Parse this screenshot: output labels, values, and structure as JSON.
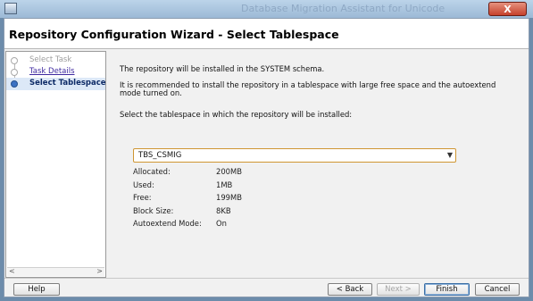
{
  "window": {
    "background_title": "Database Migration Assistant for Unicode",
    "close_glyph": "X"
  },
  "header": {
    "title": "Repository Configuration Wizard - Select Tablespace"
  },
  "steps": [
    {
      "label": "Select Task",
      "state": "disabled"
    },
    {
      "label": "Task Details",
      "state": "link"
    },
    {
      "label": "Select Tablespace",
      "state": "current"
    }
  ],
  "scrollbar": {
    "left_arrow": "<",
    "right_arrow": ">"
  },
  "main": {
    "info_line": "The repository will be installed in the SYSTEM schema.",
    "recommend_line1": "It is recommended to install the repository in a tablespace with large free space and the autoextend",
    "recommend_line2": "mode turned on.",
    "select_prompt": "Select the tablespace in which the repository will be installed:",
    "tablespace_selected": "TBS_CSMIG",
    "dropdown_arrow": "▼",
    "properties": [
      {
        "label": "Allocated:",
        "value": "200MB"
      },
      {
        "label": "Used:",
        "value": "1MB"
      },
      {
        "label": "Free:",
        "value": "199MB"
      },
      {
        "label": "Block Size:",
        "value": "8KB"
      },
      {
        "label": "Autoextend Mode:",
        "value": "On"
      }
    ]
  },
  "buttons": {
    "help": "Help",
    "back": "< Back",
    "next": "Next >",
    "finish": "Finish",
    "cancel": "Cancel"
  }
}
